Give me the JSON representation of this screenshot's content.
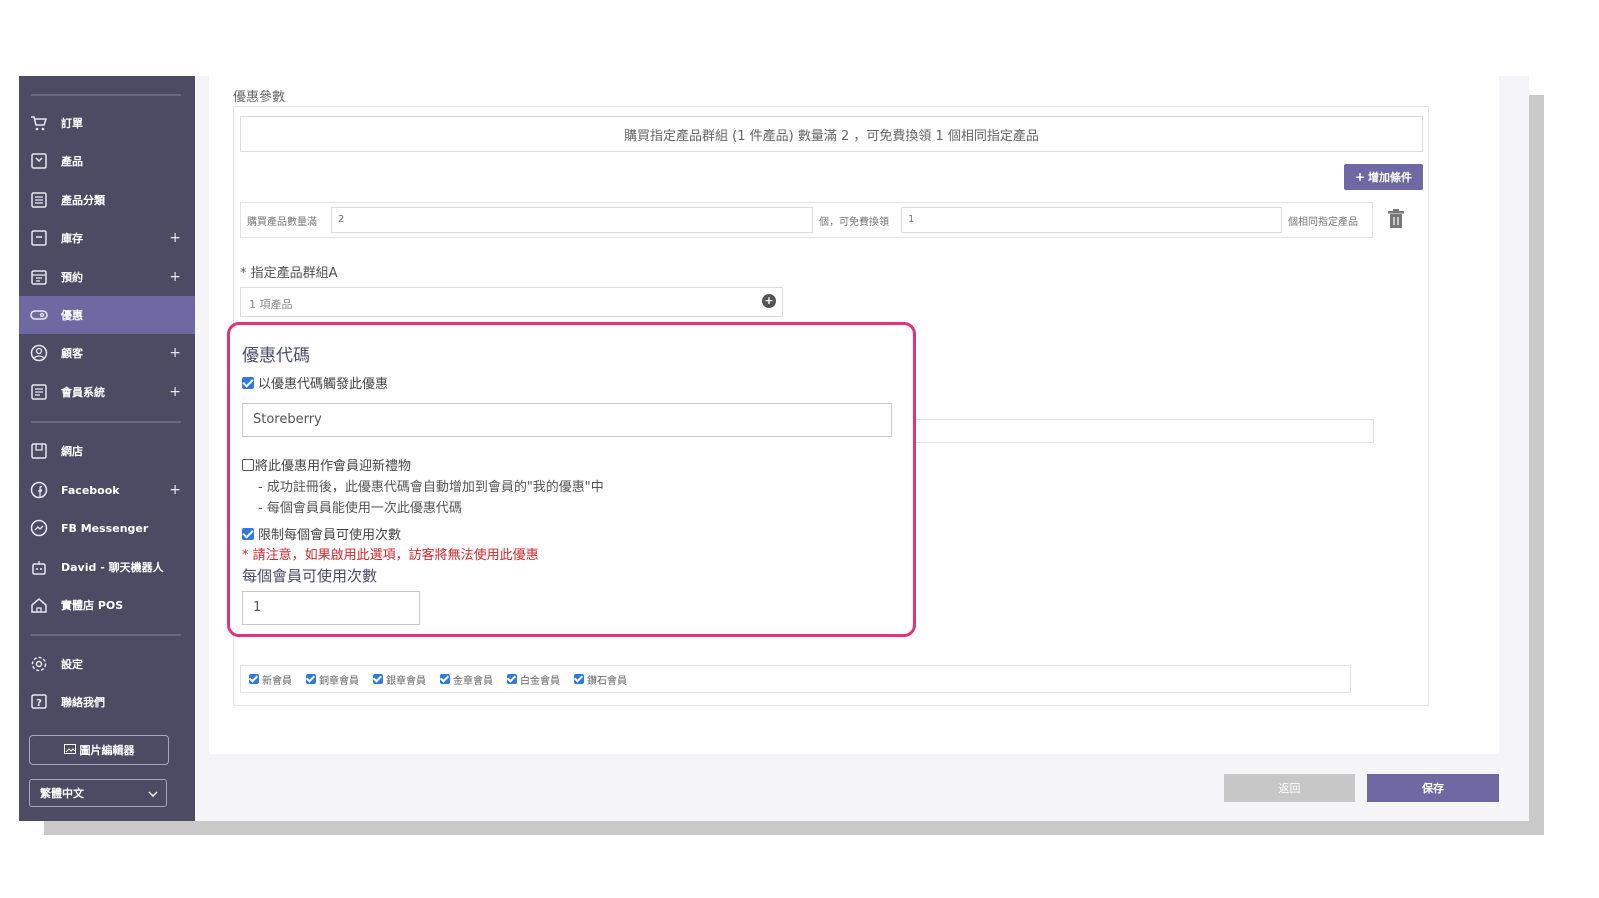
{
  "sidebar": {
    "items": [
      {
        "label": "訂單",
        "icon": "cart-icon",
        "has_plus": false
      },
      {
        "label": "產品",
        "icon": "product-icon",
        "has_plus": false
      },
      {
        "label": "產品分類",
        "icon": "list-icon",
        "has_plus": false
      },
      {
        "label": "庫存",
        "icon": "inventory-icon",
        "has_plus": true
      },
      {
        "label": "預約",
        "icon": "calendar-icon",
        "has_plus": true
      },
      {
        "label": "優惠",
        "icon": "ticket-icon",
        "has_plus": false,
        "active": true
      },
      {
        "label": "顧客",
        "icon": "user-icon",
        "has_plus": true
      },
      {
        "label": "會員系統",
        "icon": "member-icon",
        "has_plus": true
      },
      {
        "label": "網店",
        "icon": "store-icon",
        "has_plus": false
      },
      {
        "label": "Facebook",
        "icon": "facebook-icon",
        "has_plus": true
      },
      {
        "label": "FB Messenger",
        "icon": "messenger-icon",
        "has_plus": false
      },
      {
        "label": "David - 聊天機器人",
        "icon": "bot-icon",
        "has_plus": false
      },
      {
        "label": "實體店 POS",
        "icon": "home-icon",
        "has_plus": false
      },
      {
        "label": "設定",
        "icon": "gear-icon",
        "has_plus": false
      },
      {
        "label": "聯絡我們",
        "icon": "help-icon",
        "has_plus": false
      }
    ],
    "plus_glyph": "+",
    "image_editor_label": "圖片編輯器",
    "language_selected": "繁體中文"
  },
  "main": {
    "section_title": "優惠參數",
    "summary": "購買指定產品群組 (1 件產品) 數量滿 2 ，可免費換領 1 個相同指定產品",
    "add_condition_label": "增加條件",
    "condition": {
      "label_buy": "購買產品數量滿",
      "buy_value": "2",
      "label_free": "個，可免費換領",
      "free_value": "1",
      "label_same": "個相同指定產品"
    },
    "group_label": "* 指定產品群組A",
    "group_value": "1 項產品",
    "members": [
      "新會員",
      "銅章會員",
      "銀章會員",
      "金章會員",
      "白金會員",
      "鑽石會員"
    ]
  },
  "coupon": {
    "title": "優惠代碼",
    "trigger_label": "以優惠代碼觸發此優惠",
    "trigger_checked": true,
    "code_value": "Storeberry",
    "welcome_label": "將此優惠用作會員迎新禮物",
    "welcome_checked": false,
    "welcome_note1": "- 成功註冊後，此優惠代碼會自動增加到會員的\"我的優惠\"中",
    "welcome_note2": "- 每個會員員能使用一次此優惠代碼",
    "limit_label": "限制每個會員可使用次數",
    "limit_checked": true,
    "warning": "* 請注意，如果啟用此選項，訪客將無法使用此優惠",
    "uses_title": "每個會員可使用次數",
    "uses_value": "1"
  },
  "footer": {
    "back_label": "返回",
    "save_label": "保存"
  },
  "colors": {
    "sidebar_bg": "#4d4b63",
    "accent": "#6e69a3",
    "highlight_border": "#e0357e",
    "warning": "#d9262a",
    "checkbox": "#2d7be0"
  }
}
